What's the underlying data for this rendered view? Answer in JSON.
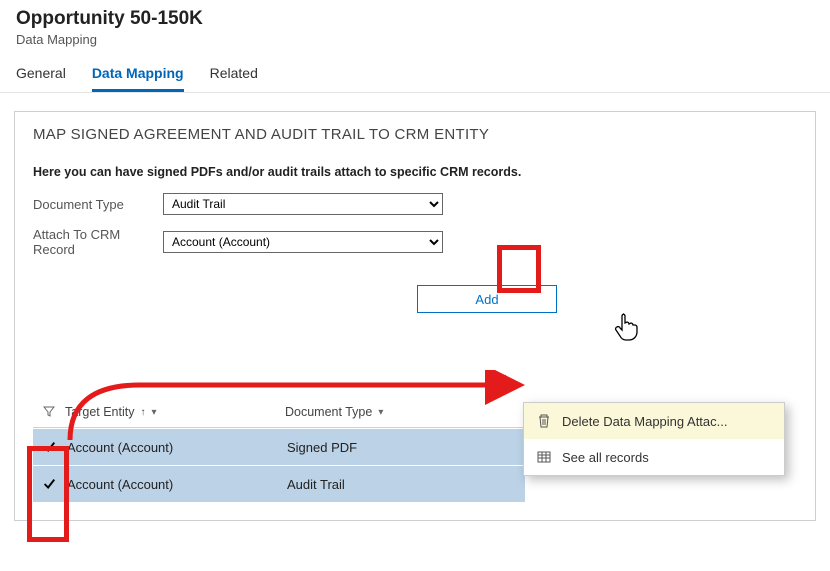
{
  "header": {
    "title": "Opportunity 50-150K",
    "subtitle": "Data Mapping"
  },
  "tabs": {
    "general": "General",
    "dataMapping": "Data Mapping",
    "related": "Related"
  },
  "section": {
    "title": "MAP SIGNED AGREEMENT AND AUDIT TRAIL TO CRM ENTITY",
    "intro": "Here you can have signed PDFs and/or audit trails attach to specific CRM records.",
    "docTypeLabel": "Document Type",
    "docTypeValue": "Audit Trail",
    "attachLabel": "Attach To CRM Record",
    "attachValue": "Account (Account)",
    "addLabel": "Add"
  },
  "grid": {
    "colEntity": "Target Entity",
    "colDoc": "Document Type",
    "rows": [
      {
        "entity": "Account (Account)",
        "doc": "Signed PDF"
      },
      {
        "entity": "Account (Account)",
        "doc": "Audit Trail"
      }
    ]
  },
  "menu": {
    "delete": "Delete Data Mapping Attac...",
    "seeAll": "See all records"
  }
}
